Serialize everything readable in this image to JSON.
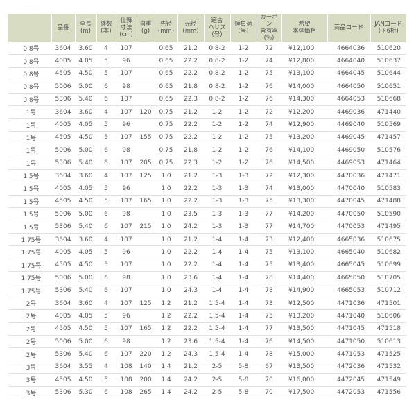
{
  "columns": [
    {
      "key": "size",
      "label": ""
    },
    {
      "key": "item",
      "label": "品番"
    },
    {
      "key": "length",
      "label": "全長\n(m)"
    },
    {
      "key": "sections",
      "label": "継数\n(本)"
    },
    {
      "key": "closed",
      "label": "仕舞\n寸法\n(cm)"
    },
    {
      "key": "weight",
      "label": "自重\n(g)"
    },
    {
      "key": "tip",
      "label": "先径\n(mm)"
    },
    {
      "key": "butt",
      "label": "元径\n(mm)"
    },
    {
      "key": "harris",
      "label": "適合\nハリス\n(号)"
    },
    {
      "key": "sinker",
      "label": "錘負荷\n(号)"
    },
    {
      "key": "carbon",
      "label": "カーボン\n含有率\n(%)"
    },
    {
      "key": "price",
      "label": "希望\n本体価格"
    },
    {
      "key": "code",
      "label": "商品コード"
    },
    {
      "key": "jan",
      "label": "JANコード\n(下6桁)"
    }
  ],
  "rows": [
    [
      "0.8号",
      "3604",
      "3.60",
      "4",
      "107",
      "",
      "0.65",
      "21.2",
      "0.8-2",
      "1-2",
      "72",
      "¥12,100",
      "4664036",
      "510620"
    ],
    [
      "0.8号",
      "4005",
      "4.05",
      "5",
      "96",
      "",
      "0.65",
      "22.2",
      "0.8-2",
      "1-2",
      "74",
      "¥12,800",
      "4664040",
      "510637"
    ],
    [
      "0.8号",
      "4505",
      "4.50",
      "5",
      "107",
      "",
      "0.65",
      "22.2",
      "0.8-2",
      "1-2",
      "75",
      "¥13,100",
      "4664045",
      "510644"
    ],
    [
      "0.8号",
      "5006",
      "5.00",
      "6",
      "98",
      "",
      "0.65",
      "21.8",
      "0.8-2",
      "1-2",
      "76",
      "¥14,000",
      "4664050",
      "510651"
    ],
    [
      "0.8号",
      "5306",
      "5.40",
      "6",
      "107",
      "",
      "0.65",
      "22.3",
      "0.8-2",
      "1-2",
      "76",
      "¥14,300",
      "4664053",
      "510668"
    ],
    [
      "1号",
      "3604",
      "3.60",
      "4",
      "107",
      "120",
      "0.75",
      "21.2",
      "1-2",
      "1-2",
      "72",
      "¥12,200",
      "4469036",
      "471440"
    ],
    [
      "1号",
      "4005",
      "4.05",
      "5",
      "96",
      "",
      "0.75",
      "22.2",
      "1-2",
      "1-2",
      "74",
      "¥12,900",
      "4469040",
      "510569"
    ],
    [
      "1号",
      "4505",
      "4.50",
      "5",
      "107",
      "155",
      "0.75",
      "22.2",
      "1-2",
      "1-2",
      "75",
      "¥13,200",
      "4469045",
      "471457"
    ],
    [
      "1号",
      "5006",
      "5.00",
      "6",
      "98",
      "",
      "0.75",
      "21.8",
      "1-2",
      "1-2",
      "76",
      "¥14,100",
      "4469050",
      "510576"
    ],
    [
      "1号",
      "5306",
      "5.40",
      "6",
      "107",
      "205",
      "0.75",
      "22.3",
      "1-2",
      "1-2",
      "76",
      "¥14,500",
      "4469053",
      "471464"
    ],
    [
      "1.5号",
      "3604",
      "3.60",
      "4",
      "107",
      "125",
      "1.0",
      "21.2",
      "1-3",
      "1-3",
      "72",
      "¥12,300",
      "4470036",
      "471471"
    ],
    [
      "1.5号",
      "4005",
      "4.05",
      "5",
      "96",
      "",
      "1.0",
      "22.2",
      "1-3",
      "1-3",
      "74",
      "¥13,000",
      "4470040",
      "510583"
    ],
    [
      "1.5号",
      "4505",
      "4.50",
      "5",
      "107",
      "165",
      "1.0",
      "22.2",
      "1-3",
      "1-3",
      "75",
      "¥13,300",
      "4470045",
      "471488"
    ],
    [
      "1.5号",
      "5006",
      "5.00",
      "6",
      "98",
      "",
      "1.0",
      "23.5",
      "1-3",
      "1-3",
      "77",
      "¥14,200",
      "4470050",
      "510590"
    ],
    [
      "1.5号",
      "5306",
      "5.40",
      "6",
      "107",
      "215",
      "1.0",
      "24.2",
      "1-3",
      "1-3",
      "77",
      "¥14,700",
      "4470053",
      "471495"
    ],
    [
      "1.75号",
      "3604",
      "3.60",
      "4",
      "107",
      "",
      "1.0",
      "21.2",
      "1-4",
      "1-4",
      "73",
      "¥12,400",
      "4665036",
      "510675"
    ],
    [
      "1.75号",
      "4005",
      "4.05",
      "5",
      "96",
      "",
      "1.0",
      "22.2",
      "1-4",
      "1-4",
      "75",
      "¥13,100",
      "4665040",
      "510682"
    ],
    [
      "1.75号",
      "4505",
      "4.50",
      "5",
      "107",
      "",
      "1.0",
      "22.2",
      "1-4",
      "1-4",
      "75",
      "¥13,400",
      "4665045",
      "510699"
    ],
    [
      "1.75号",
      "5006",
      "5.00",
      "6",
      "98",
      "",
      "1.0",
      "23.6",
      "1-4",
      "1-4",
      "78",
      "¥14,400",
      "4665050",
      "510705"
    ],
    [
      "1.75号",
      "5306",
      "5.40",
      "6",
      "107",
      "",
      "1.0",
      "24.3",
      "1-4",
      "1-4",
      "78",
      "¥14,900",
      "4665053",
      "510712"
    ],
    [
      "2号",
      "3604",
      "3.60",
      "4",
      "107",
      "125",
      "1.2",
      "21.2",
      "1.5-4",
      "1-4",
      "73",
      "¥12,500",
      "4471036",
      "471501"
    ],
    [
      "2号",
      "4005",
      "4.05",
      "5",
      "96",
      "",
      "1.2",
      "22.2",
      "1.5-4",
      "1-4",
      "75",
      "¥13,200",
      "4471040",
      "510606"
    ],
    [
      "2号",
      "4505",
      "4.50",
      "5",
      "107",
      "165",
      "1.2",
      "22.2",
      "1.5-4",
      "1-4",
      "77",
      "¥13,500",
      "4471045",
      "471518"
    ],
    [
      "2号",
      "5006",
      "5.00",
      "6",
      "98",
      "",
      "1.2",
      "23.6",
      "1.5-4",
      "1-4",
      "76",
      "¥14,500",
      "4471050",
      "510613"
    ],
    [
      "2号",
      "5306",
      "5.40",
      "6",
      "107",
      "220",
      "1.2",
      "24.3",
      "1.5-4",
      "1-4",
      "78",
      "¥15,000",
      "4471053",
      "471525"
    ],
    [
      "3号",
      "3604",
      "3.55",
      "4",
      "108",
      "140",
      "1.4",
      "21.2",
      "2-5",
      "5-8",
      "67",
      "¥13,500",
      "4472036",
      "471532"
    ],
    [
      "3号",
      "4505",
      "4.50",
      "5",
      "108",
      "200",
      "1.4",
      "24.2",
      "2-5",
      "5-8",
      "70",
      "¥16,000",
      "4472045",
      "471549"
    ],
    [
      "3号",
      "5306",
      "5.30",
      "6",
      "108",
      "265",
      "1.4",
      "24.2",
      "2-5",
      "5-8",
      "70",
      "¥17,500",
      "4472053",
      "471556"
    ]
  ]
}
